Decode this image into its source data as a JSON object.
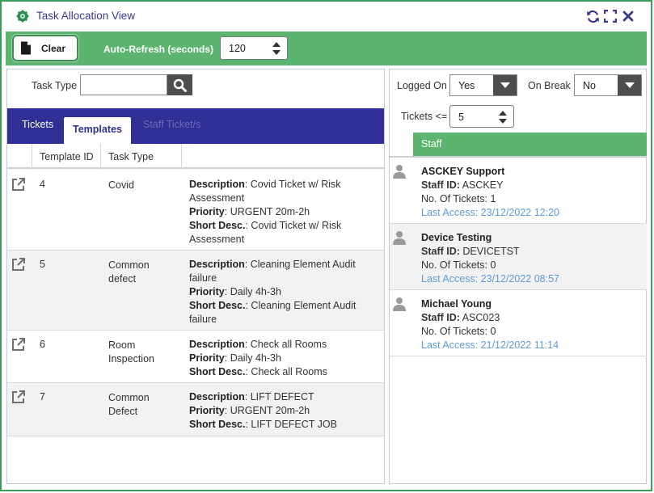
{
  "window": {
    "title": "Task Allocation View"
  },
  "toolbar": {
    "clear_label": "Clear",
    "auto_refresh_label": "Auto-Refresh (seconds)",
    "auto_refresh_value": "120"
  },
  "filters": {
    "task_type_label": "Task Type",
    "task_type_value": ""
  },
  "tabs": [
    {
      "label": "Tickets",
      "state": "normal"
    },
    {
      "label": "Templates",
      "state": "active"
    },
    {
      "label": "Staff Ticket/s",
      "state": "disabled"
    }
  ],
  "templates_table": {
    "columns": [
      "Template ID",
      "Task Type"
    ],
    "field_labels": {
      "description": "Description",
      "priority": "Priority",
      "short_desc": "Short Desc."
    },
    "rows": [
      {
        "id": "4",
        "task_type": "Covid",
        "description": "Covid Ticket w/ Risk Assessment",
        "priority": "URGENT 20m-2h",
        "short_desc": "Covid Ticket w/ Risk Assessment"
      },
      {
        "id": "5",
        "task_type": "Common defect",
        "description": "Cleaning Element Audit failure",
        "priority": "Daily 4h-3h",
        "short_desc": "Cleaning Element Audit failure"
      },
      {
        "id": "6",
        "task_type": "Room Inspection",
        "description": "Check all Rooms",
        "priority": "Daily 4h-3h",
        "short_desc": "Check all Rooms"
      },
      {
        "id": "7",
        "task_type": "Common Defect",
        "description": "LIFT DEFECT",
        "priority": "URGENT 20m-2h",
        "short_desc": "LIFT DEFECT JOB"
      }
    ]
  },
  "staff_filters": {
    "logged_on_label": "Logged On",
    "logged_on_value": "Yes",
    "on_break_label": "On Break",
    "on_break_value": "No",
    "tickets_label": "Tickets <=",
    "tickets_value": "5"
  },
  "staff_list": {
    "header": "Staff",
    "field_labels": {
      "staff_id": "Staff ID:",
      "tickets": "No. Of Tickets:",
      "last_access": "Last Access:"
    },
    "items": [
      {
        "name": "ASCKEY Support",
        "staff_id": "ASCKEY",
        "tickets": "1",
        "last_access": "23/12/2022 12:20"
      },
      {
        "name": "Device Testing",
        "staff_id": "DEVICETST",
        "tickets": "0",
        "last_access": "23/12/2022 08:57"
      },
      {
        "name": "Michael Young",
        "staff_id": "ASC023",
        "tickets": "0",
        "last_access": "21/12/2022 11:14"
      }
    ]
  },
  "icons": [
    "app-gear-icon",
    "refresh-icon",
    "expand-icon",
    "close-icon",
    "document-icon",
    "search-icon",
    "chevron-down-icon",
    "external-link-icon",
    "user-icon"
  ],
  "colors": {
    "accent_green": "#5cb56e",
    "tab_blue": "#2f2f96",
    "title_text": "#3a3a8c",
    "link_blue": "#5e9bd6"
  }
}
